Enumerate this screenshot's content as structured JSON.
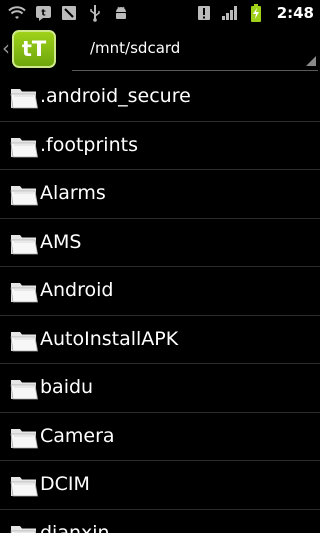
{
  "status_bar": {
    "time": "2:48",
    "icons": [
      "wifi-icon",
      "talk-icon",
      "sim-icon",
      "usb-icon",
      "android-debug-icon",
      "alert-icon",
      "signal-icon",
      "battery-charging-icon"
    ]
  },
  "action_bar": {
    "app_icon_text": "tT",
    "path": "/mnt/sdcard"
  },
  "files": [
    {
      "name": ".android_secure"
    },
    {
      "name": ".footprints"
    },
    {
      "name": "Alarms"
    },
    {
      "name": "AMS"
    },
    {
      "name": "Android"
    },
    {
      "name": "AutoInstallAPK"
    },
    {
      "name": "baidu"
    },
    {
      "name": "Camera"
    },
    {
      "name": "DCIM"
    },
    {
      "name": "dianxin"
    }
  ],
  "colors": {
    "background": "#000000",
    "app_icon": "#8cc415",
    "divider": "#2b2b2b"
  }
}
